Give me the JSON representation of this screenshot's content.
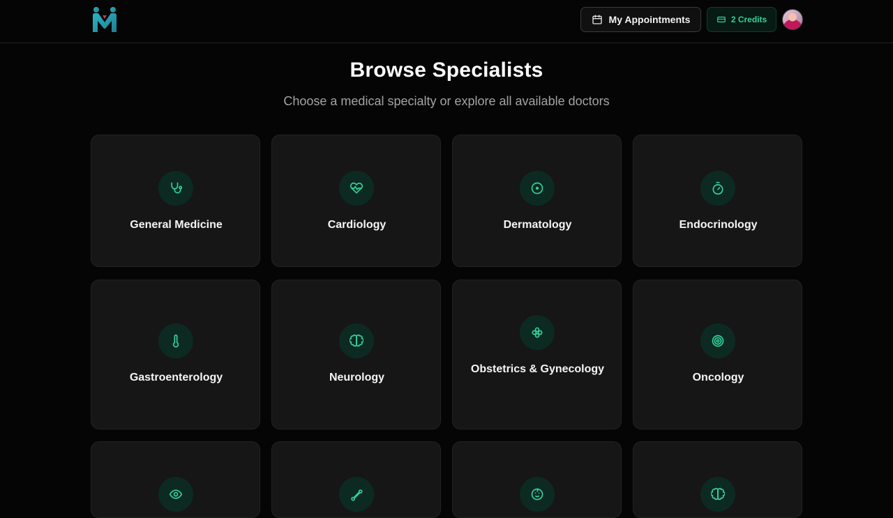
{
  "header": {
    "appointments_label": "My Appointments",
    "credits_label": "2 Credits",
    "accent_color": "#34d399"
  },
  "page": {
    "title": "Browse Specialists",
    "subtitle": "Choose a medical specialty or explore all available doctors"
  },
  "specialties": [
    {
      "label": "General Medicine",
      "icon": "stethoscope-icon"
    },
    {
      "label": "Cardiology",
      "icon": "heart-pulse-icon"
    },
    {
      "label": "Dermatology",
      "icon": "circle-dot-icon"
    },
    {
      "label": "Endocrinology",
      "icon": "timer-icon"
    },
    {
      "label": "Gastroenterology",
      "icon": "thermometer-icon"
    },
    {
      "label": "Neurology",
      "icon": "brain-icon"
    },
    {
      "label": "Obstetrics & Gynecology",
      "icon": "flower-icon"
    },
    {
      "label": "Oncology",
      "icon": "target-icon"
    },
    {
      "label": "",
      "icon": "eye-icon"
    },
    {
      "label": "",
      "icon": "bone-icon"
    },
    {
      "label": "",
      "icon": "baby-icon"
    },
    {
      "label": "",
      "icon": "brain-icon"
    }
  ]
}
